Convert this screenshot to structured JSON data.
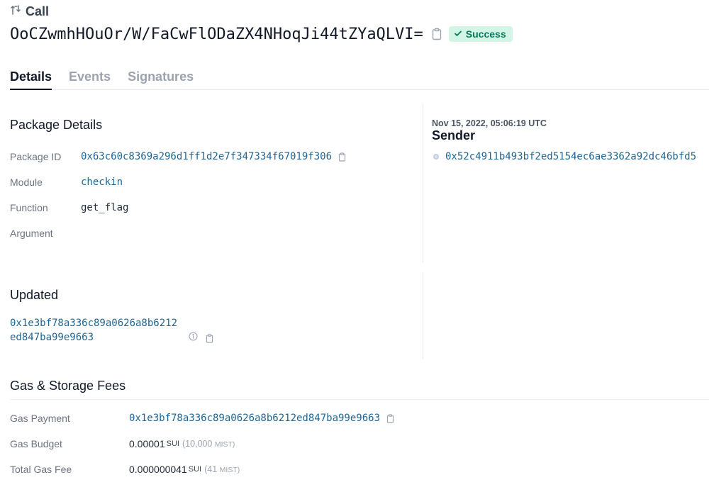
{
  "header": {
    "type_label": "Call",
    "digest": "OoCZwmhHOuOr/W/FaCwFlODaZX4NHoqJi44tZYaQLVI=",
    "status": "Success"
  },
  "tabs": [
    {
      "label": "Details",
      "active": true
    },
    {
      "label": "Events",
      "active": false
    },
    {
      "label": "Signatures",
      "active": false
    }
  ],
  "package_details": {
    "title": "Package Details",
    "package_id_label": "Package ID",
    "package_id": "0x63c60c8369a296d1ff1d2e7f347334f67019f306",
    "module_label": "Module",
    "module": "checkin",
    "function_label": "Function",
    "function": "get_flag",
    "argument_label": "Argument"
  },
  "sender": {
    "timestamp": "Nov 15, 2022, 05:06:19 UTC",
    "title": "Sender",
    "address": "0x52c4911b493bf2ed5154ec6ae3362a92dc46bfd5"
  },
  "updated": {
    "title": "Updated",
    "object_line1": "0x1e3bf78a336c89a0626a8b6212",
    "object_line2": "ed847ba99e9663"
  },
  "gas": {
    "title": "Gas & Storage Fees",
    "payment_label": "Gas Payment",
    "payment": "0x1e3bf78a336c89a0626a8b6212ed847ba99e9663",
    "budget_label": "Gas Budget",
    "budget_value": "0.00001",
    "budget_unit": "SUI",
    "budget_mist_open": "(10,000",
    "budget_mist_unit": "MIST)",
    "total_label": "Total Gas Fee",
    "total_value": "0.000000041",
    "total_unit": "SUI",
    "total_mist_open": "(41",
    "total_mist_unit": "MIST)"
  },
  "colors": {
    "link": "#1f6493",
    "success_bg": "#d3f5e6",
    "success_text": "#047857"
  }
}
